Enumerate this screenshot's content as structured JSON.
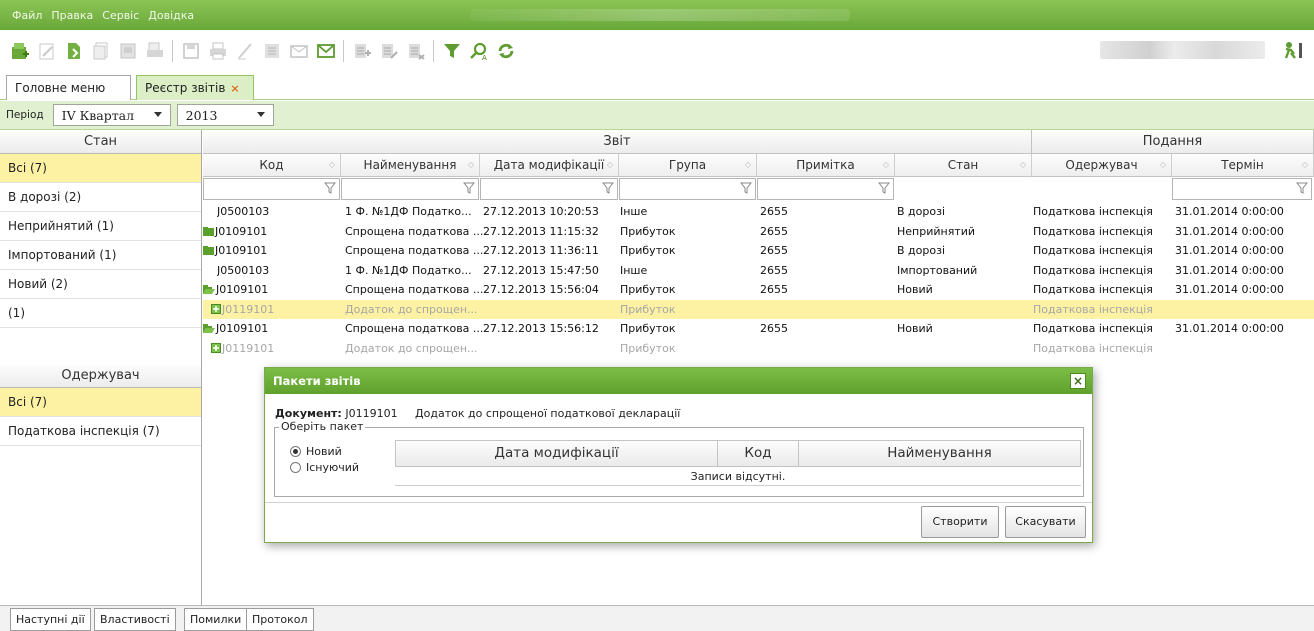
{
  "menu": {
    "items": [
      "Файл",
      "Правка",
      "Сервіс",
      "Довідка"
    ]
  },
  "toolbar": {
    "icons": [
      "new-report-icon",
      "edit-icon",
      "open-icon",
      "copy-icon",
      "import-icon",
      "print-preview-icon",
      "save-icon",
      "print-icon",
      "sign-icon",
      "encrypt-icon",
      "send-icon",
      "receive-icon",
      "package-add-icon",
      "package-edit-icon",
      "package-remove-icon",
      "filter-icon",
      "find-icon",
      "refresh-icon"
    ],
    "exit_icon": "exit-icon"
  },
  "tabs": [
    {
      "label": "Головне меню"
    },
    {
      "label": "Реєстр звітів",
      "close": "×"
    }
  ],
  "period": {
    "label": "Період",
    "quarter": "IV Квартал",
    "year": "2013"
  },
  "left_panel": {
    "state_header": "Стан",
    "states": [
      {
        "label": "Всі (7)",
        "selected": true
      },
      {
        "label": "В дорозі (2)"
      },
      {
        "label": "Неприйнятий (1)"
      },
      {
        "label": "Імпортований (1)"
      },
      {
        "label": "Новий (2)"
      },
      {
        "label": "(1)"
      }
    ],
    "recipient_header": "Одержувач",
    "recipients": [
      {
        "label": "Всі (7)",
        "selected": true
      },
      {
        "label": "Податкова інспекція (7)"
      }
    ]
  },
  "grid": {
    "groups": [
      "Звіт",
      "Подання"
    ],
    "columns": [
      "Код",
      "Найменування",
      "Дата модифікації",
      "Група",
      "Примітка",
      "Стан",
      "Одержувач",
      "Термін"
    ],
    "rows": [
      {
        "icon": "",
        "code": "J0500103",
        "name": "1 Ф. №1ДФ Податко...",
        "date": "27.12.2013 10:20:53",
        "group": "Інше",
        "note": "2655",
        "state": "В дорозі",
        "recipient": "Податкова інспекція",
        "term": "31.01.2014 0:00:00"
      },
      {
        "icon": "folder-closed-icon",
        "code": "J0109101",
        "name": "Спрощена податкова ...",
        "date": "27.12.2013 11:15:32",
        "group": "Прибуток",
        "note": "2655",
        "state": "Неприйнятий",
        "recipient": "Податкова інспекція",
        "term": "31.01.2014 0:00:00"
      },
      {
        "icon": "folder-closed-icon",
        "code": "J0109101",
        "name": "Спрощена податкова ...",
        "date": "27.12.2013 11:36:11",
        "group": "Прибуток",
        "note": "2655",
        "state": "В дорозі",
        "recipient": "Податкова інспекція",
        "term": "31.01.2014 0:00:00"
      },
      {
        "icon": "",
        "code": "J0500103",
        "name": "1 Ф. №1ДФ Податко...",
        "date": "27.12.2013 15:47:50",
        "group": "Інше",
        "note": "2655",
        "state": "Імпортований",
        "recipient": "Податкова інспекція",
        "term": "31.01.2014 0:00:00"
      },
      {
        "icon": "folder-open-icon",
        "code": "J0109101",
        "name": "Спрощена податкова ...",
        "date": "27.12.2013 15:56:04",
        "group": "Прибуток",
        "note": "2655",
        "state": "Новий",
        "recipient": "Податкова інспекція",
        "term": "31.01.2014 0:00:00"
      },
      {
        "icon": "attachment-icon",
        "code": "J0119101",
        "name": "Додаток до спрощен...",
        "date": "",
        "group": "Прибуток",
        "note": "",
        "state": "",
        "recipient": "Податкова інспекція",
        "term": "",
        "dim": true,
        "highlight": true,
        "child": true
      },
      {
        "icon": "folder-open-icon",
        "code": "J0109101",
        "name": "Спрощена податкова ...",
        "date": "27.12.2013 15:56:12",
        "group": "Прибуток",
        "note": "2655",
        "state": "Новий",
        "recipient": "Податкова інспекція",
        "term": "31.01.2014 0:00:00"
      },
      {
        "icon": "attachment-icon",
        "code": "J0119101",
        "name": "Додаток до спрощен...",
        "date": "",
        "group": "Прибуток",
        "note": "",
        "state": "",
        "recipient": "Податкова інспекція",
        "term": "",
        "dim": true,
        "child": true
      }
    ]
  },
  "bottom_tabs": [
    "Наступні дії",
    "Властивості",
    "Помилки",
    "Протокол"
  ],
  "dialog": {
    "title": "Пакети звітів",
    "close": "×",
    "document_label": "Документ:",
    "document_code": "J0119101",
    "document_name": "Додаток до спрощеної податкової декларації",
    "group_label": "Оберіть пакет",
    "radio_new": "Новий",
    "radio_existing": "Існуючий",
    "columns": [
      "Дата модифікації",
      "Код",
      "Найменування"
    ],
    "empty_text": "Записи відсутні.",
    "create_button": "Створити",
    "cancel_button": "Скасувати"
  }
}
